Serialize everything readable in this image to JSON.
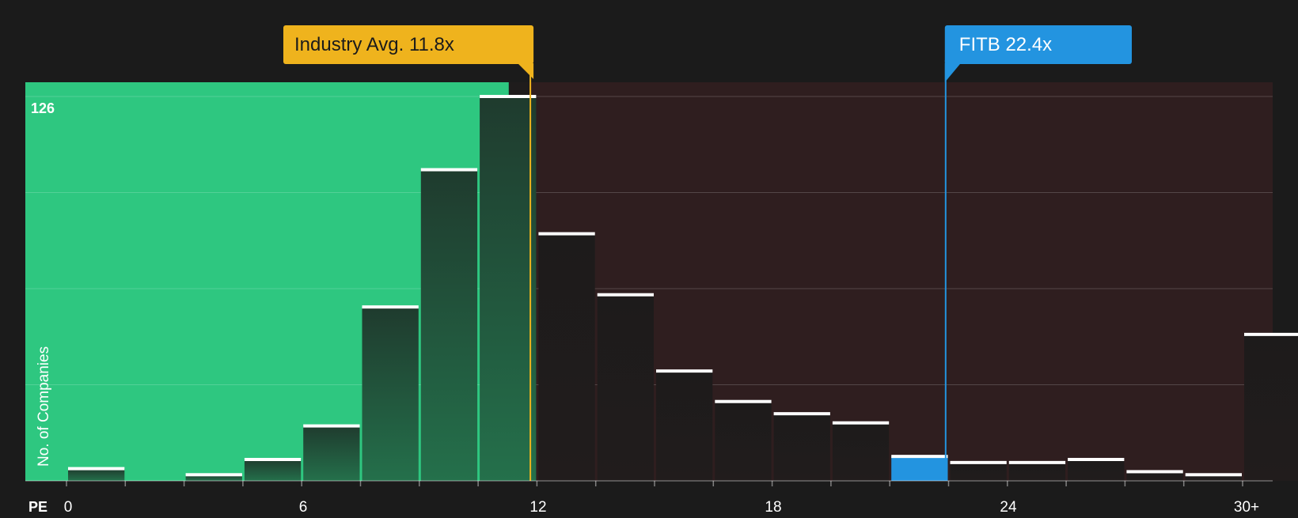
{
  "chart_data": {
    "type": "bar",
    "x_axis_label": "PE",
    "y_axis_label": "No. of Companies",
    "y_max_label": "126",
    "ylim": [
      0,
      126
    ],
    "x_ticks": [
      "0",
      "6",
      "12",
      "18",
      "24",
      "30+"
    ],
    "bins": [
      {
        "range": "0-1.5",
        "value": 4
      },
      {
        "range": "1.5-3",
        "value": 0
      },
      {
        "range": "3-4.5",
        "value": 2
      },
      {
        "range": "4.5-6",
        "value": 7
      },
      {
        "range": "6-7.5",
        "value": 18
      },
      {
        "range": "7.5-9",
        "value": 57
      },
      {
        "range": "9-10.5",
        "value": 102
      },
      {
        "range": "10.5-12",
        "value": 126
      },
      {
        "range": "12-13.5",
        "value": 81
      },
      {
        "range": "13.5-15",
        "value": 61
      },
      {
        "range": "15-16.5",
        "value": 36
      },
      {
        "range": "16.5-18",
        "value": 26
      },
      {
        "range": "18-19.5",
        "value": 22
      },
      {
        "range": "19.5-21",
        "value": 19
      },
      {
        "range": "21-22.5",
        "value": 8
      },
      {
        "range": "22.5-24",
        "value": 6
      },
      {
        "range": "24-25.5",
        "value": 6
      },
      {
        "range": "25.5-27",
        "value": 7
      },
      {
        "range": "27-28.5",
        "value": 3
      },
      {
        "range": "28.5-30",
        "value": 2
      },
      {
        "range": "30+",
        "value": 48
      }
    ],
    "industry_avg": {
      "label": "Industry Avg. 11.8x",
      "value": 11.8
    },
    "company": {
      "label": "FITB 22.4x",
      "value": 22.4,
      "bin_index": 14
    },
    "colors": {
      "background": "#1b1b1b",
      "undervalued_zone": "#2ec780",
      "overvalued_zone": "#2f1e1f",
      "industry_marker": "#efb31d",
      "company_marker": "#2394e0",
      "bar_cap": "#ffffff"
    }
  }
}
